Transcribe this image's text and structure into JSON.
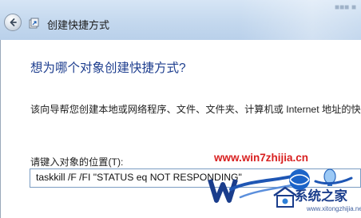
{
  "window": {
    "title": "创建快捷方式",
    "title_faded": "■■■ ■"
  },
  "wizard": {
    "heading": "想为哪个对象创建快捷方式?",
    "description": "该向导帮您创建本地或网络程序、文件、文件夹、计算机或 Internet 地址的快",
    "location_label": "请键入对象的位置(T):",
    "location_value": "taskkill /F /FI  \"STATUS eq NOT RESPONDING\""
  },
  "watermark": {
    "url": "www.win7zhijia.cn",
    "brand": "系统之家",
    "domain": "www.xitongzhijia.net"
  },
  "colors": {
    "heading": "#1f3f8f",
    "watermark_url": "#d81f1f",
    "watermark_brand": "#1a3d8c",
    "titlebar": "#c4d8ee"
  },
  "icons": {
    "back": "back-arrow-icon",
    "shortcut": "shortcut-icon",
    "logo": "win7-logo-icon"
  }
}
